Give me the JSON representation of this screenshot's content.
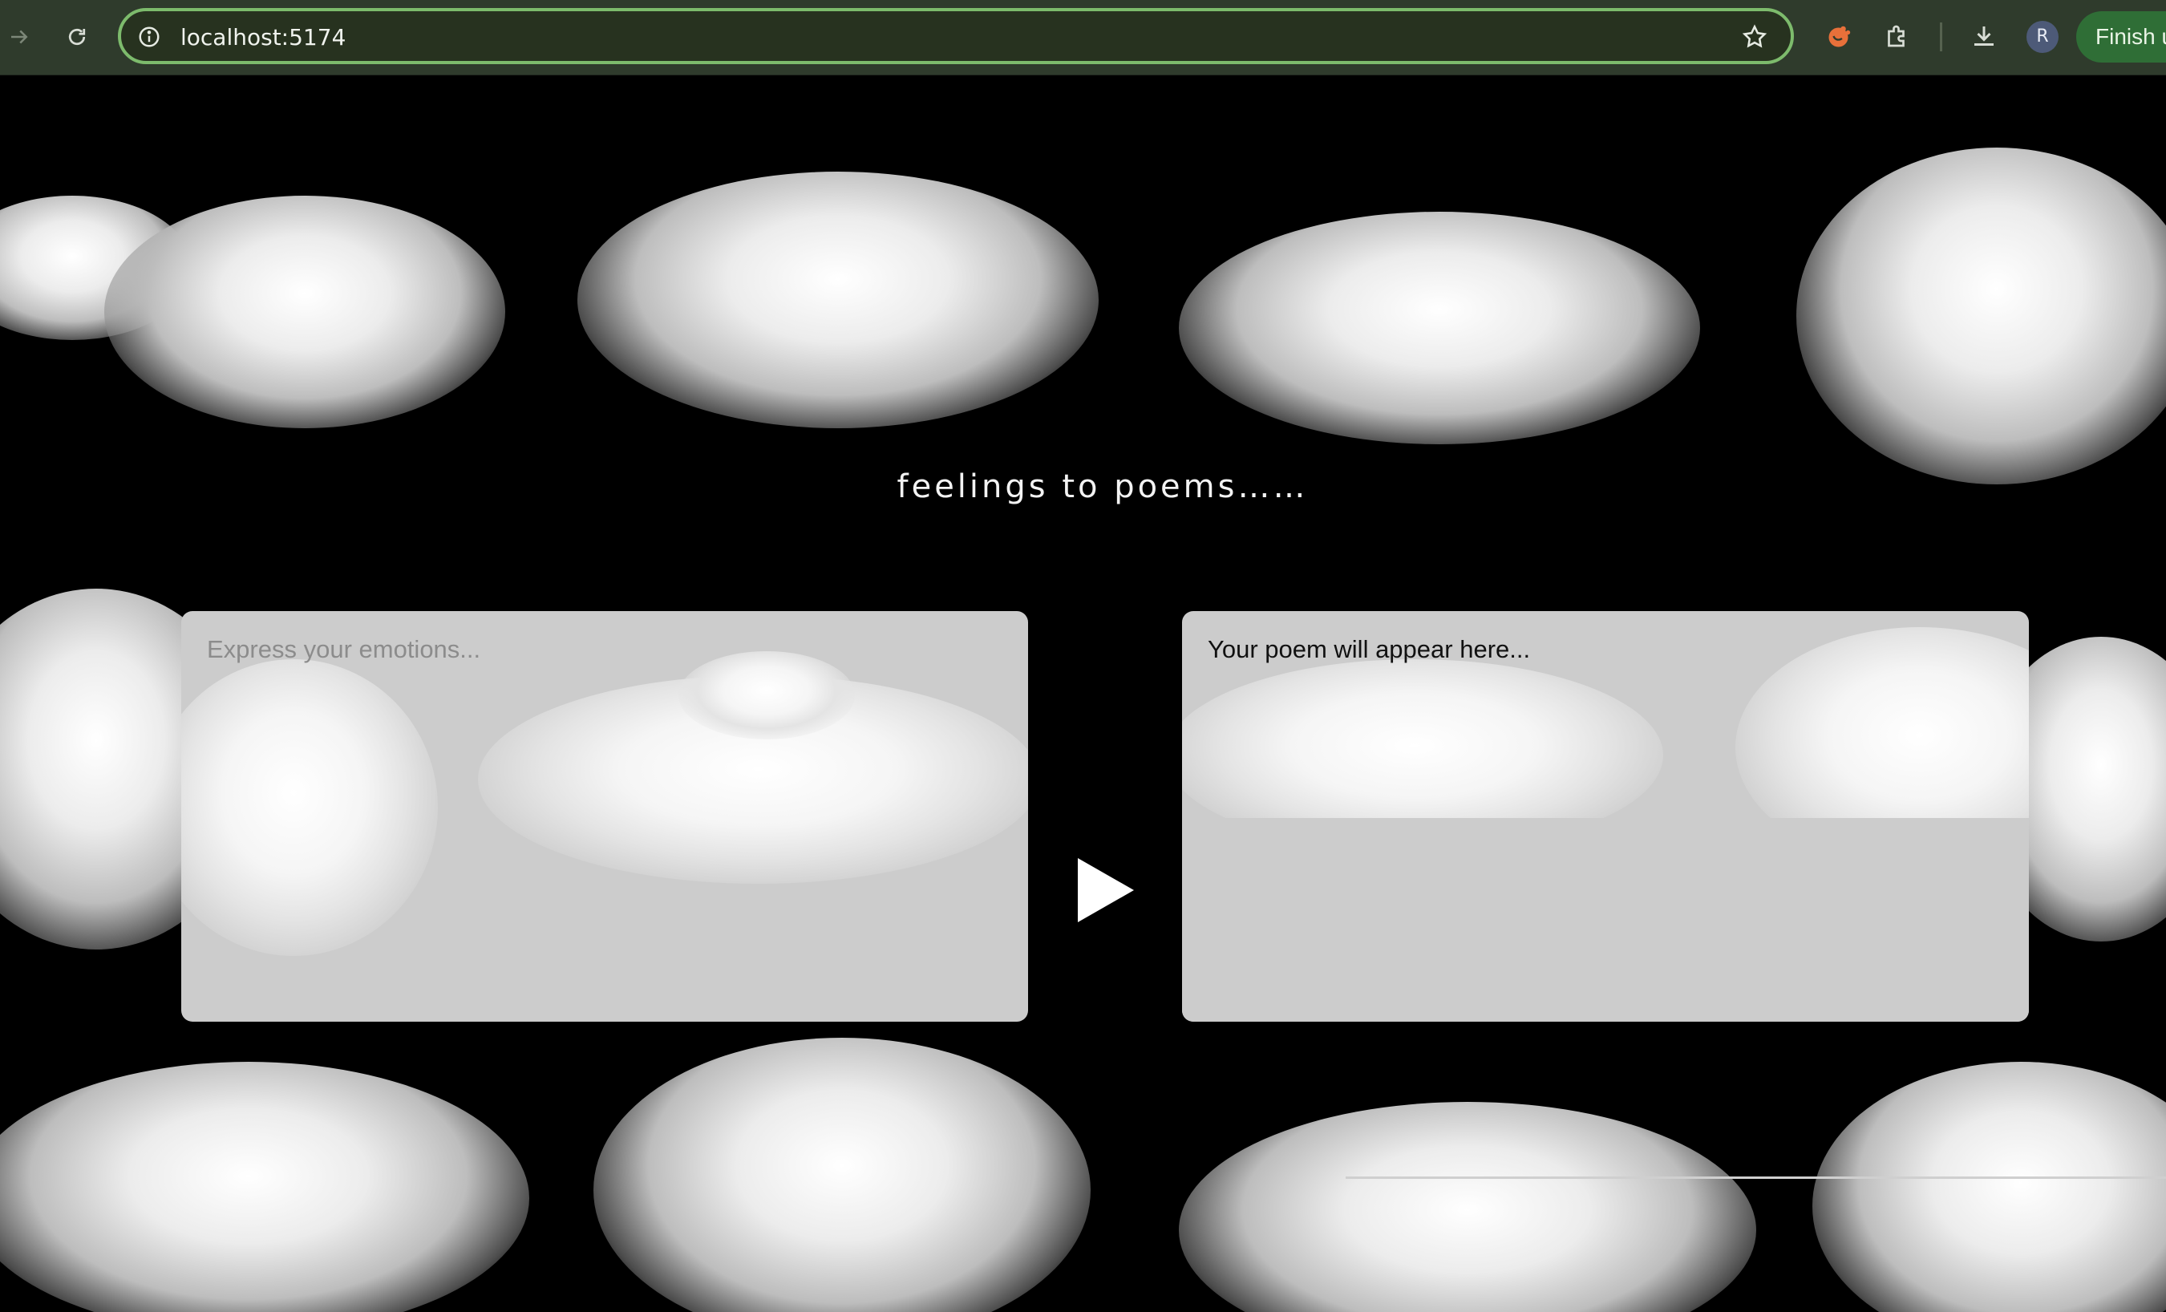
{
  "browser": {
    "url": "localhost:5174",
    "avatar_initial": "R",
    "finish_label": "Finish u"
  },
  "page": {
    "title": "feelings to poems……",
    "input_placeholder": "Express your emotions...",
    "output_placeholder": "Your poem will appear here..."
  },
  "colors": {
    "background": "#000000",
    "panel": "#cccccc",
    "chrome": "#2f3b2c",
    "omnibox_border": "#7dbb6c",
    "finish_button": "#2f6e36"
  }
}
